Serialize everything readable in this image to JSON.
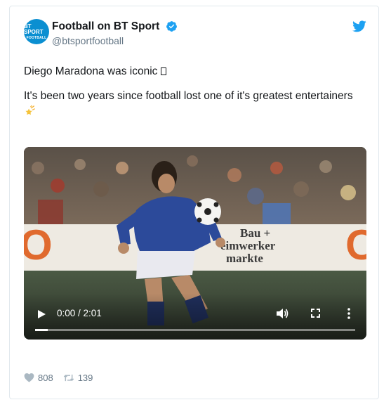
{
  "account": {
    "display_name": "Football on BT Sport",
    "handle": "@btsportfootball",
    "avatar_line1": "BT SPORT",
    "avatar_line2": "FOOTBALL",
    "verified": true,
    "brand_color": "#0b8fd1"
  },
  "tweet": {
    "line1": "Diego Maradona was iconic",
    "line2": "It's been two years since football lost one of it's greatest entertainers",
    "emoji_icon": "shooting-star-icon",
    "missing_glyph_icon": "missing-glyph-box"
  },
  "video": {
    "time_display": "0:00 / 2:01",
    "progress_fraction": 0.04,
    "banner_text_1": "Bau +",
    "banner_text_2": "eimwerker",
    "banner_text_3": "markte",
    "banner_fragment_left": "O",
    "banner_fragment_right": "O"
  },
  "actions": {
    "likes": "808",
    "retweets": "139"
  },
  "colors": {
    "text": "#14171a",
    "muted": "#657786",
    "twitter_blue": "#1da1f2",
    "border": "#e1e8ed"
  }
}
